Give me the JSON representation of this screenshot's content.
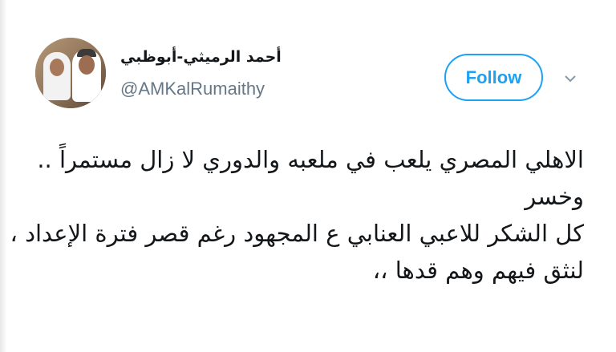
{
  "profile": {
    "display_name": "أحمد الرميثي-أبوظبي",
    "handle": "@AMKalRumaithy",
    "avatar_icon": "profile-photo"
  },
  "actions": {
    "follow_label": "Follow",
    "more_icon": "chevron-down-icon"
  },
  "tweet": {
    "lines": [
      "الاهلي المصري يلعب في ملعبه والدوري لا زال مستمراً ..",
      "وخسر",
      "كل الشكر للاعبي العنابي ع المجهود رغم قصر فترة الإعداد ،",
      "لنثق فيهم وهم قدها ،،"
    ]
  },
  "colors": {
    "accent": "#1da1f2",
    "secondary_text": "#657786",
    "primary_text": "#14171a"
  }
}
